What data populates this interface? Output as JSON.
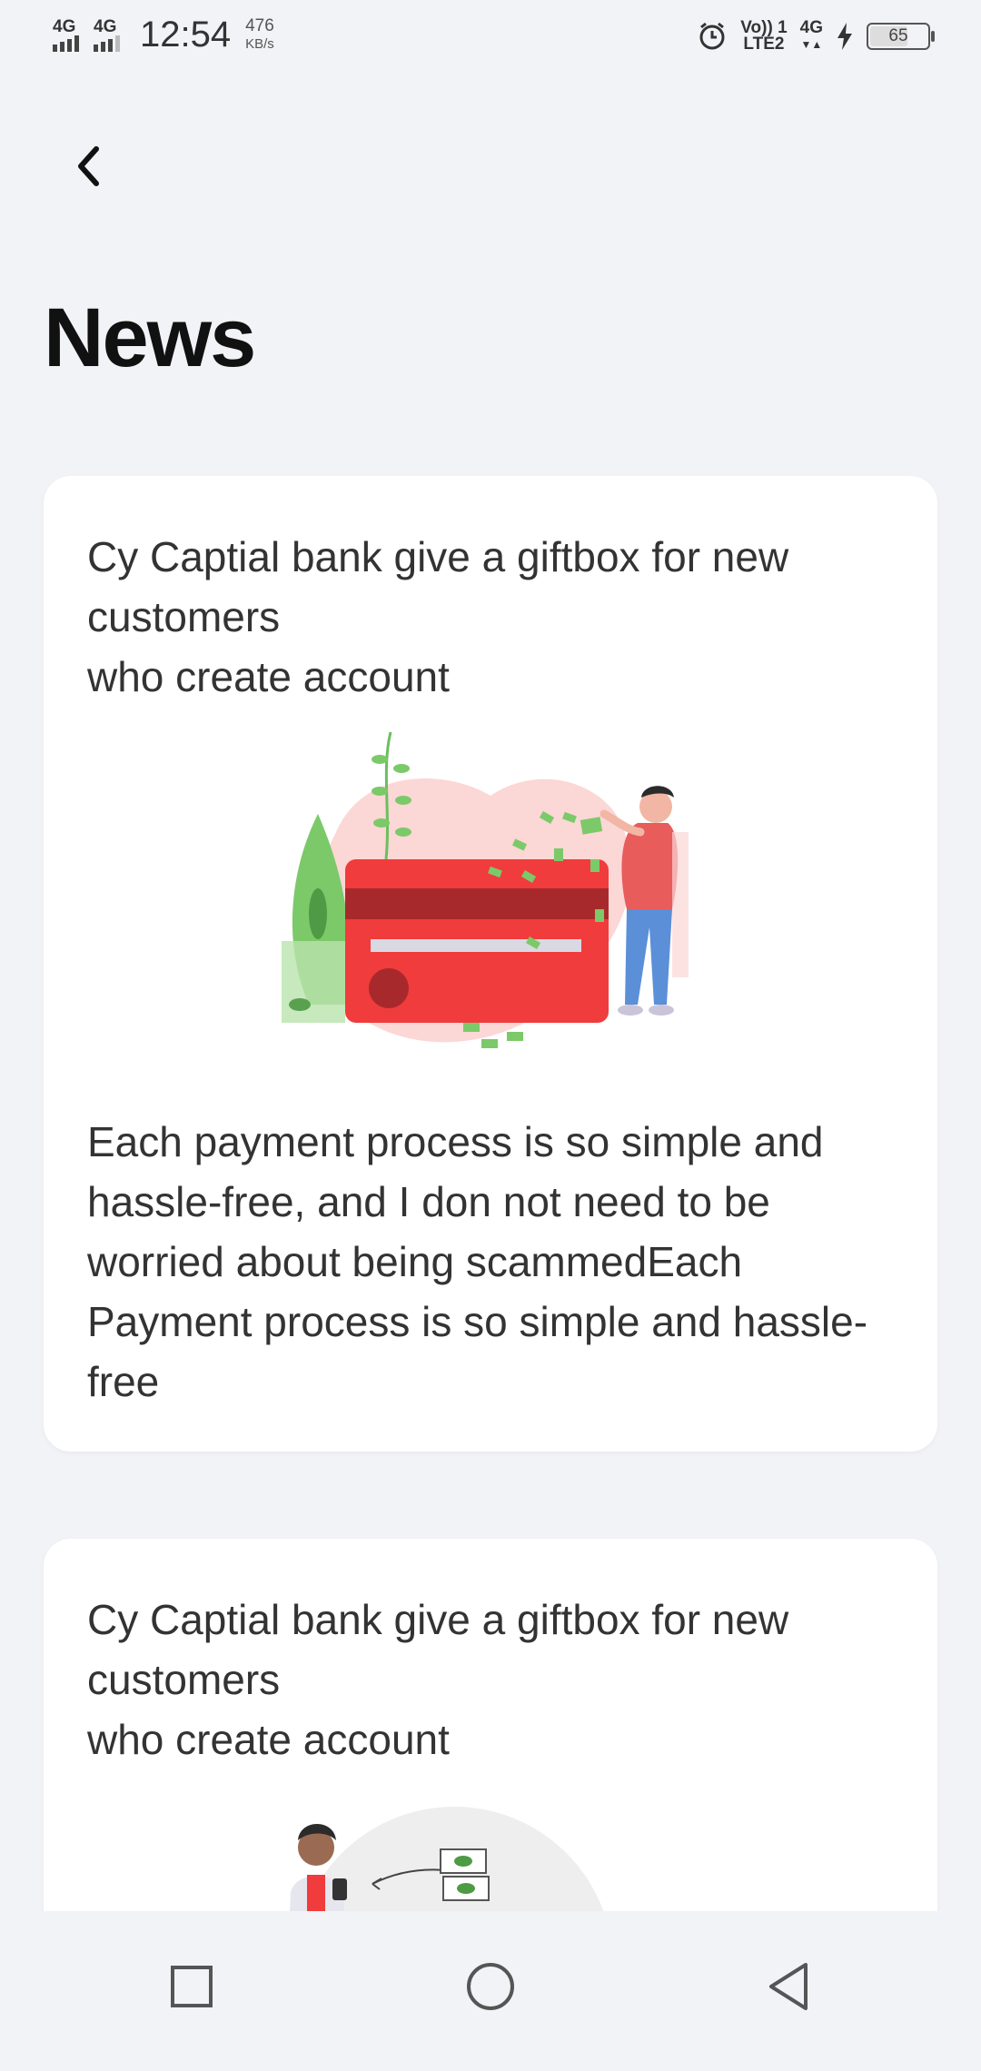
{
  "status_bar": {
    "network_1": "4G",
    "network_2": "4G",
    "time": "12:54",
    "speed_value": "476",
    "speed_unit": "KB/s",
    "volte": "Vo)) 1",
    "lte2": "LTE2",
    "network_3": "4G",
    "battery": "65",
    "icons": [
      "alarm-icon",
      "charging-icon",
      "battery-icon"
    ]
  },
  "header": {
    "title": "News",
    "back_icon": "back-chevron-icon"
  },
  "news": [
    {
      "title": "Cy Captial bank give a giftbox for new customers\nwho create account",
      "illustration": "credit-card-money-illustration",
      "body": "Each payment process is so simple and hassle-free, and I don not need to be worried about being scammedEach Payment process is so simple and hassle-free"
    },
    {
      "title": "Cy Captial bank give a giftbox for new customers\nwho create account",
      "illustration": "person-sending-money-illustration"
    }
  ],
  "nav_bar": {
    "icons": [
      "recent-apps-icon",
      "home-icon",
      "back-icon"
    ]
  },
  "colors": {
    "background": "#f2f3f7",
    "card": "#ffffff",
    "accent_red": "#f03c3c",
    "accent_green": "#7cc96a"
  }
}
